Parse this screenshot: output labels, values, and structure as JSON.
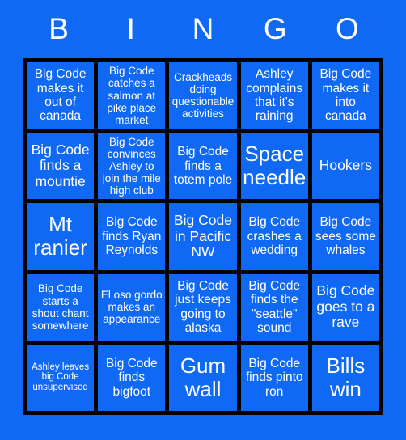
{
  "header": {
    "letters": [
      "B",
      "I",
      "N",
      "G",
      "O"
    ]
  },
  "colors": {
    "background": "#1069f5",
    "cell_fill": "#1069f5",
    "grid_line": "#000000",
    "text": "#ffffff"
  },
  "grid": {
    "columns": 5,
    "rows": 5,
    "cells": [
      {
        "text": "Big Code makes it out of canada",
        "size": "fs-m"
      },
      {
        "text": "Big Code catches a salmon at pike place market",
        "size": "fs-s"
      },
      {
        "text": "Crackheads doing questionable activities",
        "size": "fs-s"
      },
      {
        "text": "Ashley complains that it's raining",
        "size": "fs-m"
      },
      {
        "text": "Big Code makes it into canada",
        "size": "fs-m"
      },
      {
        "text": "Big Code finds a mountie",
        "size": "fs-l"
      },
      {
        "text": "Big Code convinces Ashley to join the mile high club",
        "size": "fs-s"
      },
      {
        "text": "Big Code finds a totem pole",
        "size": "fs-m"
      },
      {
        "text": "Space needle",
        "size": "fs-xl"
      },
      {
        "text": "Hookers",
        "size": "fs-l"
      },
      {
        "text": "Mt ranier",
        "size": "fs-xl"
      },
      {
        "text": "Big Code finds Ryan Reynolds",
        "size": "fs-m"
      },
      {
        "text": "Big Code in Pacific NW",
        "size": "fs-l"
      },
      {
        "text": "Big Code crashes a wedding",
        "size": "fs-m"
      },
      {
        "text": "Big Code sees some whales",
        "size": "fs-m"
      },
      {
        "text": "Big Code starts a shout chant somewhere",
        "size": "fs-s"
      },
      {
        "text": "El oso gordo makes an appearance",
        "size": "fs-s"
      },
      {
        "text": "Big Code just keeps going to alaska",
        "size": "fs-m"
      },
      {
        "text": "Big Code finds the \"seattle\" sound",
        "size": "fs-m"
      },
      {
        "text": "Big Code goes to a rave",
        "size": "fs-l"
      },
      {
        "text": "Ashley leaves big Code unsupervised",
        "size": "fs-xs"
      },
      {
        "text": "Big Code finds bigfoot",
        "size": "fs-m"
      },
      {
        "text": "Gum wall",
        "size": "fs-xl"
      },
      {
        "text": "Big Code finds pinto ron",
        "size": "fs-m"
      },
      {
        "text": "Bills win",
        "size": "fs-xl"
      }
    ]
  }
}
